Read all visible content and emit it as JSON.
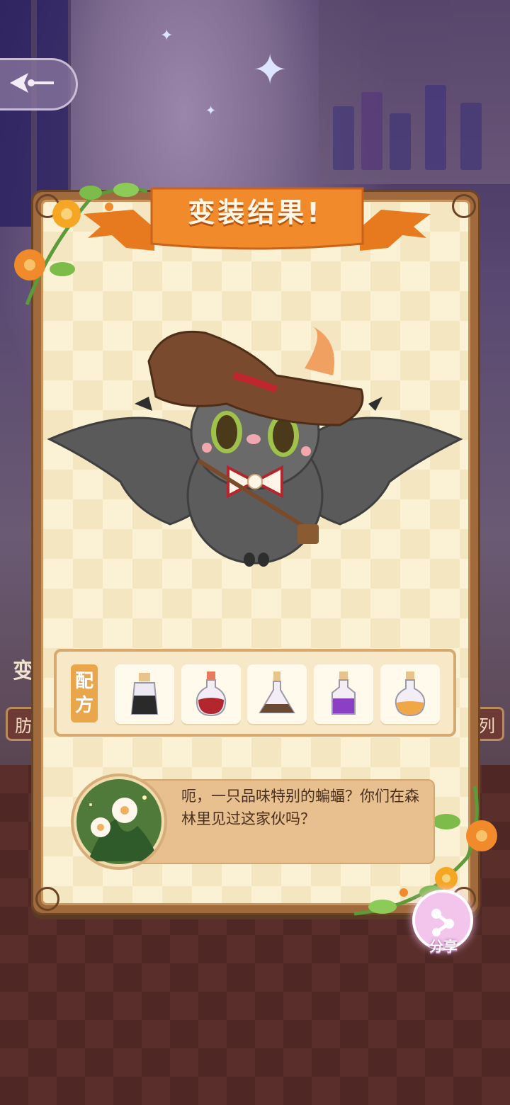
{
  "result_title": "变装结果!",
  "recipe": {
    "label_line1": "配",
    "label_line2": "方",
    "potions": [
      {
        "name": "black-potion-icon",
        "color": "#2a2a2a"
      },
      {
        "name": "red-potion-icon",
        "color": "#b3262e"
      },
      {
        "name": "brown-potion-icon",
        "color": "#6b4a33"
      },
      {
        "name": "purple-potion-icon",
        "color": "#8a3fc4"
      },
      {
        "name": "orange-potion-icon",
        "color": "#f0a846"
      }
    ]
  },
  "dialog": {
    "text": "呃，一只品味特别的蝙蝠？你们在森林里见过这家伙吗？"
  },
  "share": {
    "label": "分享"
  },
  "background": {
    "left_text": "变",
    "left_tab": "肪",
    "right_tab": "列"
  },
  "colors": {
    "ribbon": "#f08a2a",
    "card_frame": "#a06a3c",
    "accent": "#e9a64a"
  }
}
